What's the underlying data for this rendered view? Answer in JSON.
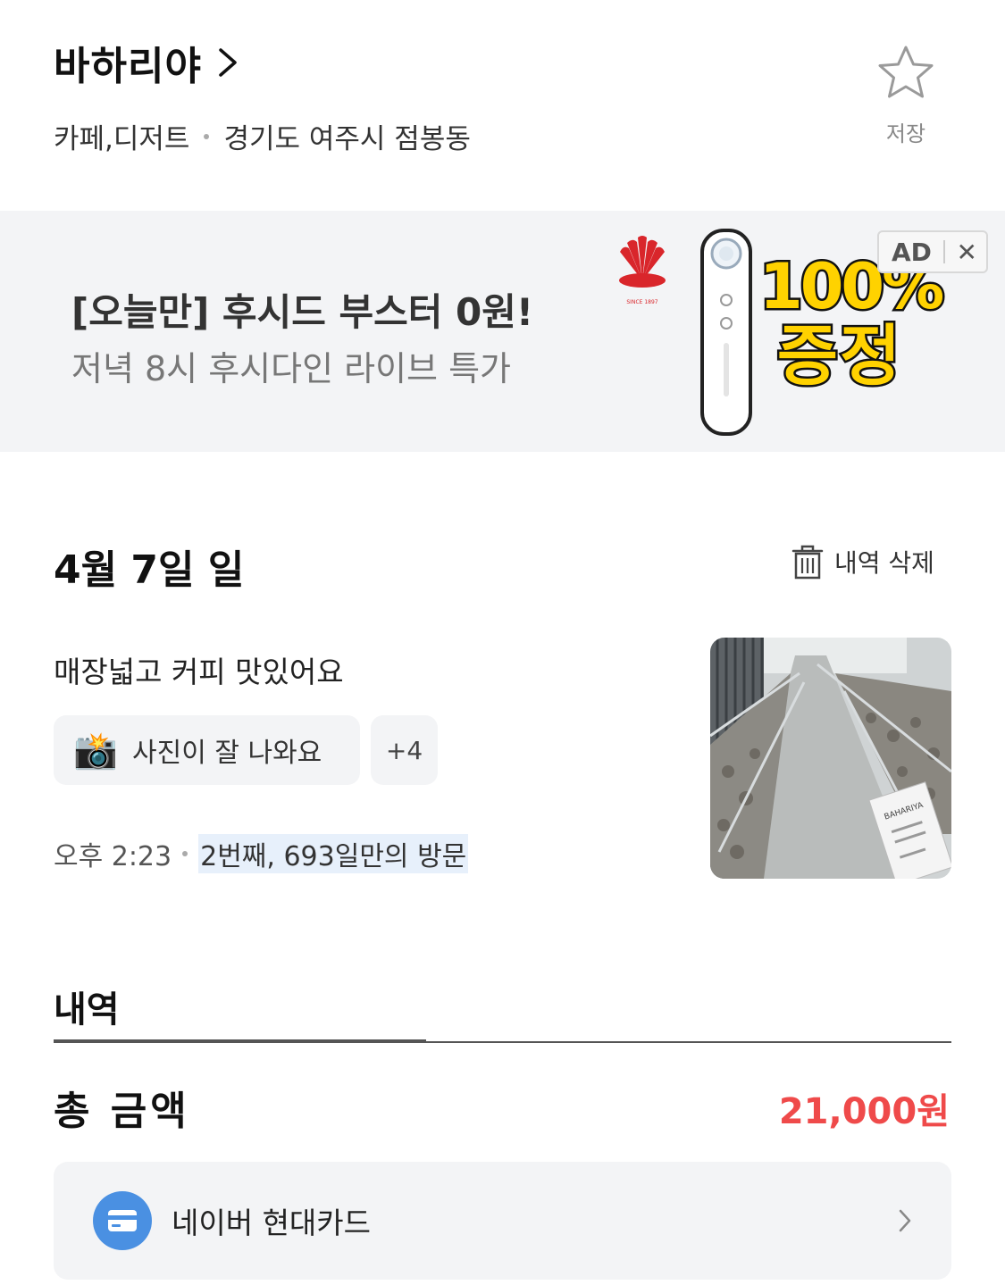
{
  "place": {
    "name": "바하리야",
    "category": "카페,디저트",
    "location": "경기도 여주시 점봉동",
    "save_label": "저장"
  },
  "ad": {
    "headline": "[오늘만] 후시드 부스터 0원!",
    "subtext": "저녁 8시 후시다인 라이브 특가",
    "logo_text": "SINCE 1897",
    "promo_line1": "100%",
    "promo_line2": "증정",
    "badge_label": "AD",
    "close_glyph": "✕"
  },
  "visit": {
    "date": "4월 7일 일",
    "delete_label": "내역 삭제",
    "review": "매장넓고 커피 맛있어요",
    "tag_emoji": "📸",
    "tag_label": "사진이 잘 나와요",
    "more_tags": "+4",
    "time": "오후 2:23",
    "visit_count": "2번째, 693일만의 방문",
    "photo_sign_text": "BAHARIYA"
  },
  "history": {
    "tab_label": "내역",
    "total_label": "총 금액",
    "total_amount": "21,000원",
    "payment_method": "네이버 현대카드"
  },
  "colors": {
    "accent_red": "#ef4a4a",
    "card_icon_blue": "#4a90e2",
    "banner_bg": "#f3f4f6",
    "promo_yellow": "#ffd200"
  }
}
